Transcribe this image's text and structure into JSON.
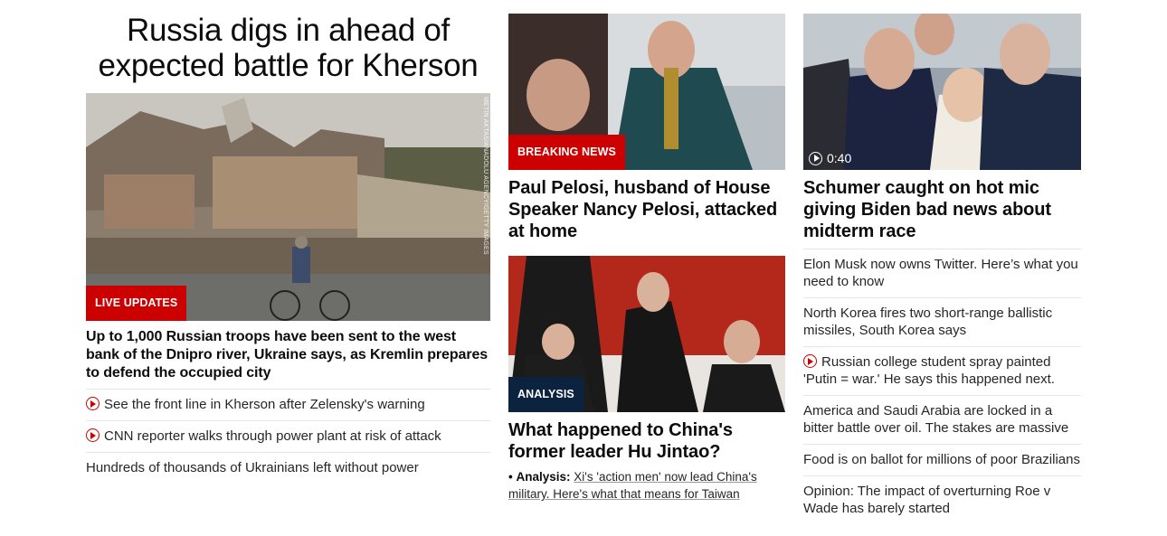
{
  "lead": {
    "headline": "Russia digs in ahead of expected battle for Kherson",
    "tag": "LIVE UPDATES",
    "photo_credit": "METIN AKTAS/ANADOLU AGENCY/GETTY IMAGES",
    "subhead": "Up to 1,000 Russian troops have been sent to the west bank of the Dnipro river, Ukraine says, as Kremlin prepares to defend the occupied city",
    "links": [
      {
        "text": "See the front line in Kherson after Zelensky's warning",
        "video": true
      },
      {
        "text": "CNN reporter walks through power plant at risk of attack",
        "video": true
      },
      {
        "text": "Hundreds of thousands of Ukrainians left without power",
        "video": false
      }
    ]
  },
  "story_pelosi": {
    "tag": "BREAKING NEWS",
    "headline": "Paul Pelosi, husband of House Speaker Nancy Pelosi, attacked at home"
  },
  "story_china": {
    "tag": "ANALYSIS",
    "headline": "What happened to China's former leader Hu Jintao?",
    "bullet": "•",
    "analysis_label": "Analysis:",
    "analysis_text": "Xi's 'action men' now lead China's military. Here's what that means for Taiwan"
  },
  "story_schumer": {
    "video_length": "0:40",
    "headline": "Schumer caught on hot mic giving Biden bad news about midterm race",
    "links": [
      {
        "text": "Elon Musk now owns Twitter. Here’s what you need to know",
        "video": false
      },
      {
        "text": "North Korea fires two short-range ballistic missiles, South Korea says",
        "video": false
      },
      {
        "text": "Russian college student spray painted 'Putin = war.' He says this happened next.",
        "video": true
      },
      {
        "text": "America and Saudi Arabia are locked in a bitter battle over oil. The stakes are massive",
        "video": false
      },
      {
        "text": "Food is on ballot for millions of poor Brazilians",
        "video": false
      },
      {
        "text": "Opinion: The impact of overturning Roe v Wade has barely started",
        "video": false
      }
    ]
  },
  "colors": {
    "accent_red": "#cc0000",
    "analysis_navy": "#0c2340",
    "text": "#0c0c0c"
  }
}
